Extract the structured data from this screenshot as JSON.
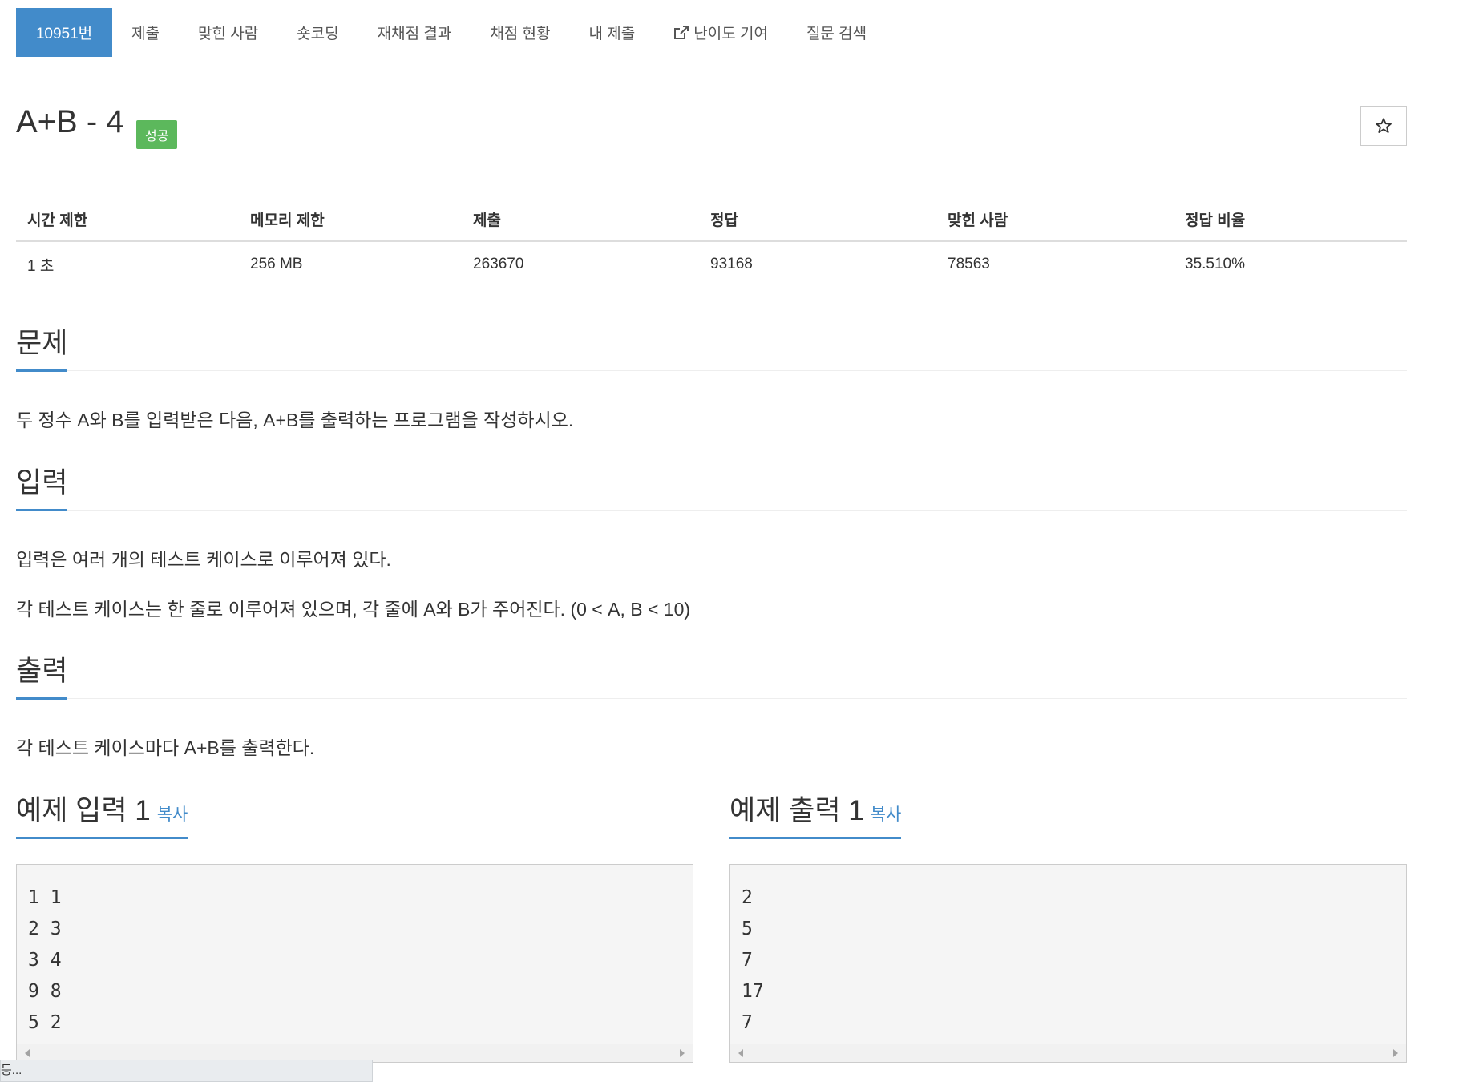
{
  "nav": {
    "items": [
      {
        "label": "10951번",
        "active": true
      },
      {
        "label": "제출"
      },
      {
        "label": "맞힌 사람"
      },
      {
        "label": "숏코딩"
      },
      {
        "label": "재채점 결과"
      },
      {
        "label": "채점 현황"
      },
      {
        "label": "내 제출"
      },
      {
        "label": "난이도 기여",
        "icon": "external-link-icon"
      },
      {
        "label": "질문 검색"
      }
    ]
  },
  "problem": {
    "title": "A+B - 4",
    "badge": "성공",
    "badge_color": "#5cb85c",
    "star_icon": "star-outline-icon"
  },
  "info_table": {
    "headers": [
      "시간 제한",
      "메모리 제한",
      "제출",
      "정답",
      "맞힌 사람",
      "정답 비율"
    ],
    "values": [
      "1 초",
      "256 MB",
      "263670",
      "93168",
      "78563",
      "35.510%"
    ]
  },
  "sections": {
    "problem": {
      "title": "문제",
      "text": "두 정수 A와 B를 입력받은 다음, A+B를 출력하는 프로그램을 작성하시오."
    },
    "input": {
      "title": "입력",
      "lines": [
        "입력은 여러 개의 테스트 케이스로 이루어져 있다.",
        "각 테스트 케이스는 한 줄로 이루어져 있으며, 각 줄에 A와 B가 주어진다. (0 < A, B < 10)"
      ]
    },
    "output": {
      "title": "출력",
      "text": "각 테스트 케이스마다 A+B를 출력한다."
    }
  },
  "samples": {
    "input": {
      "title": "예제 입력 1",
      "copy_label": "복사",
      "content": "1 1\n2 3\n3 4\n9 8\n5 2"
    },
    "output": {
      "title": "예제 출력 1",
      "copy_label": "복사",
      "content": "2\n5\n7\n17\n7"
    }
  },
  "status_bar": {
    "text": "등..."
  },
  "colors": {
    "accent": "#428bca",
    "success": "#5cb85c"
  }
}
